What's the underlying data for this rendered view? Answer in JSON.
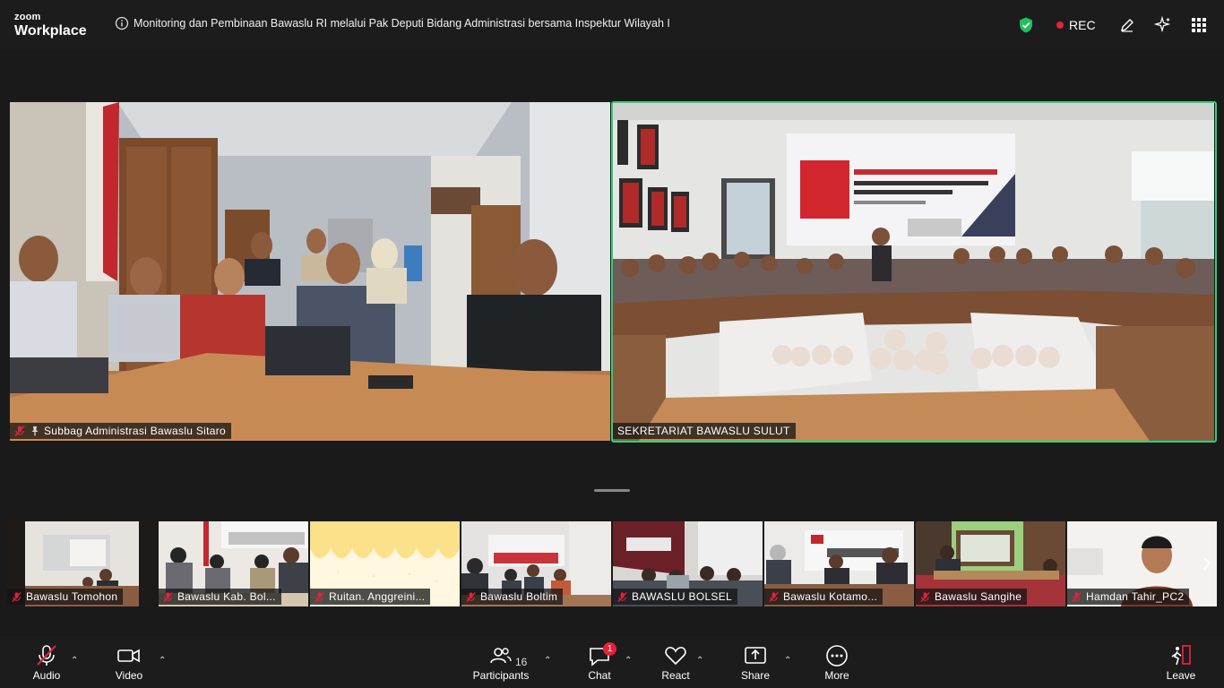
{
  "app": {
    "logo_line1": "zoom",
    "logo_line2": "Workplace"
  },
  "meeting": {
    "title": "Monitoring dan Pembinaan Bawaslu RI melalui Pak Deputi Bidang Administrasi bersama Inspektur Wilayah I"
  },
  "status": {
    "recording_label": "REC"
  },
  "main_videos": [
    {
      "name": "Subbag Administrasi Bawaslu Sitaro",
      "muted": true,
      "pinned": true
    },
    {
      "name": "SEKRETARIAT BAWASLU SULUT",
      "muted": false,
      "pinned": false,
      "active_speaker": true
    }
  ],
  "filmstrip": [
    {
      "name": "Bawaslu Tomohon",
      "muted": true
    },
    {
      "name": "Bawaslu Kab. Bol...",
      "muted": true
    },
    {
      "name": "Ruitan. Anggreini...",
      "muted": true
    },
    {
      "name": "Bawaslu Boltim",
      "muted": true
    },
    {
      "name": "BAWASLU BOLSEL",
      "muted": true
    },
    {
      "name": "Bawaslu Kotamo...",
      "muted": true
    },
    {
      "name": "Bawaslu Sangihe",
      "muted": true
    },
    {
      "name": "Hamdan Tahir_PC2",
      "muted": true
    }
  ],
  "toolbar": {
    "audio": "Audio",
    "video": "Video",
    "participants": "Participants",
    "participants_count": "16",
    "chat": "Chat",
    "chat_badge": "1",
    "react": "React",
    "share": "Share",
    "more": "More",
    "leave": "Leave"
  },
  "colors": {
    "accent_green": "#2fd07a",
    "record_red": "#e0243a",
    "muted_red": "#e0243a"
  }
}
